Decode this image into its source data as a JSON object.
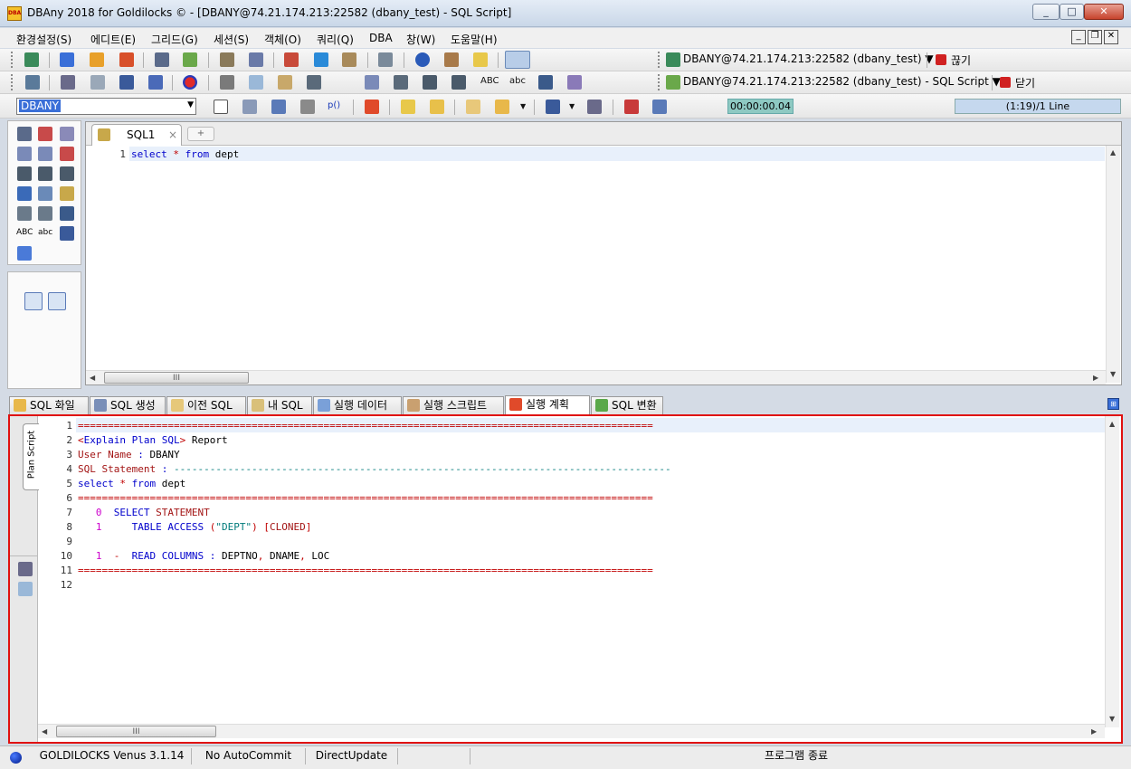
{
  "window": {
    "title": "DBAny 2018 for Goldilocks © - [DBANY@74.21.174.213:22582 (dbany_test) - SQL Script]",
    "app_icon_text": "DBA",
    "minimize": "_",
    "maximize": "□",
    "close": "✕"
  },
  "menu": {
    "items": [
      "환경설정(S)",
      "에디트(E)",
      "그리드(G)",
      "세션(S)",
      "객체(O)",
      "쿼리(Q)",
      "DBA",
      "창(W)",
      "도움말(H)"
    ],
    "mdi_min": "_",
    "mdi_restore": "❐",
    "mdi_close": "✕"
  },
  "toolbar1": {
    "connection": "DBANY@74.21.174.213:22582 (dbany_test) ▼",
    "disconnect": "끊기"
  },
  "toolbar2": {
    "text_abc_upper": "ABC",
    "text_abc_lower": "abc",
    "script_window": "DBANY@74.21.174.213:22582 (dbany_test) - SQL Script ▼",
    "close": "닫기"
  },
  "toolbar3": {
    "database": "DBANY",
    "param_label": "p()",
    "elapsed": "00:00:00.04",
    "line_info": "(1:19)/1 Line"
  },
  "side_tools": {
    "abc_upper": "ABC",
    "abc_lower": "abc"
  },
  "editor": {
    "tab_label": "SQL1",
    "tab_close": "×",
    "new_tab": "+",
    "lines": [
      {
        "num": "1",
        "parts": [
          {
            "t": "select",
            "c": "kw"
          },
          {
            "t": " * ",
            "c": "red"
          },
          {
            "t": "from",
            "c": "kw"
          },
          {
            "t": " dept",
            "c": ""
          }
        ]
      }
    ],
    "scroll_grip": "III"
  },
  "bottom_tabs": [
    {
      "label": "SQL 화일",
      "icon_color": "#e8b84a"
    },
    {
      "label": "SQL 생성",
      "icon_color": "#7a8fb8"
    },
    {
      "label": "이전 SQL",
      "icon_color": "#e6c87a"
    },
    {
      "label": "내 SQL",
      "icon_color": "#d9c07a"
    },
    {
      "label": "실행 데이터",
      "icon_color": "#7aa0d8"
    },
    {
      "label": "실행 스크립트",
      "icon_color": "#c9a070"
    },
    {
      "label": "실행 계획",
      "icon_color": "#e04a2a",
      "active": true
    },
    {
      "label": "SQL 변환",
      "icon_color": "#5aa84a"
    }
  ],
  "pin": "⊞",
  "result": {
    "side_tab": "Plan Script",
    "lines": [
      {
        "num": "1",
        "parts": [
          {
            "t": "================================================================================================",
            "c": "red"
          }
        ]
      },
      {
        "num": "2",
        "parts": [
          {
            "t": "<",
            "c": "red"
          },
          {
            "t": "Explain Plan SQL",
            "c": "kw"
          },
          {
            "t": "> ",
            "c": "red"
          },
          {
            "t": "Report",
            "c": ""
          }
        ]
      },
      {
        "num": "3",
        "parts": [
          {
            "t": "User Name",
            "c": "str"
          },
          {
            "t": " : ",
            "c": "kw"
          },
          {
            "t": "DBANY",
            "c": ""
          }
        ]
      },
      {
        "num": "4",
        "parts": [
          {
            "t": "SQL Statement",
            "c": "str"
          },
          {
            "t": " : ",
            "c": "kw"
          },
          {
            "t": "-----------------------------------------------------------------------------------",
            "c": "teal"
          }
        ]
      },
      {
        "num": "5",
        "parts": [
          {
            "t": "select",
            "c": "kw"
          },
          {
            "t": " * ",
            "c": "red"
          },
          {
            "t": "from",
            "c": "kw"
          },
          {
            "t": " dept",
            "c": ""
          }
        ]
      },
      {
        "num": "6",
        "parts": [
          {
            "t": "================================================================================================",
            "c": "red"
          }
        ]
      },
      {
        "num": "7",
        "parts": [
          {
            "t": "   0  ",
            "c": "mag"
          },
          {
            "t": "SELECT",
            "c": "kw"
          },
          {
            "t": " STATEMENT",
            "c": "str"
          }
        ]
      },
      {
        "num": "8",
        "parts": [
          {
            "t": "   1     ",
            "c": "mag"
          },
          {
            "t": "TABLE ACCESS",
            "c": "kw"
          },
          {
            "t": " (",
            "c": "red"
          },
          {
            "t": "\"DEPT\"",
            "c": "teal"
          },
          {
            "t": ") [",
            "c": "red"
          },
          {
            "t": "CLONED",
            "c": "str"
          },
          {
            "t": "]",
            "c": "red"
          }
        ]
      },
      {
        "num": "9",
        "parts": []
      },
      {
        "num": "10",
        "parts": [
          {
            "t": "   1  ",
            "c": "mag"
          },
          {
            "t": "-  ",
            "c": "red"
          },
          {
            "t": "READ COLUMNS",
            "c": "kw"
          },
          {
            "t": " : ",
            "c": "kw"
          },
          {
            "t": "DEPTNO",
            "c": ""
          },
          {
            "t": ", ",
            "c": "red"
          },
          {
            "t": "DNAME",
            "c": ""
          },
          {
            "t": ", ",
            "c": "red"
          },
          {
            "t": "LOC",
            "c": ""
          }
        ]
      },
      {
        "num": "11",
        "parts": [
          {
            "t": "================================================================================================",
            "c": "red"
          }
        ]
      },
      {
        "num": "12",
        "parts": []
      }
    ],
    "scroll_grip": "III"
  },
  "status": {
    "db_version": "GOLDILOCKS Venus 3.1.14",
    "autocommit": "No AutoCommit",
    "update_mode": "DirectUpdate",
    "message": "프로그램 종료"
  }
}
